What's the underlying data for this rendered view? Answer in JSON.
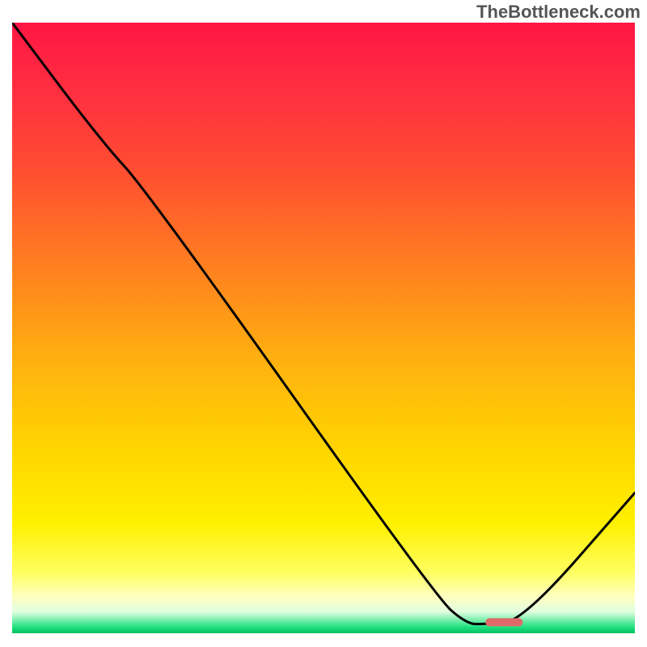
{
  "watermark": "TheBottleneck.com",
  "chart_data": {
    "type": "line",
    "title": "",
    "xlabel": "",
    "ylabel": "",
    "xlim": [
      0,
      100
    ],
    "ylim": [
      0,
      100
    ],
    "gradient_stops": [
      {
        "offset": 0.0,
        "color": "#ff1744"
      },
      {
        "offset": 0.12,
        "color": "#ff3040"
      },
      {
        "offset": 0.25,
        "color": "#ff5030"
      },
      {
        "offset": 0.4,
        "color": "#ff8020"
      },
      {
        "offset": 0.55,
        "color": "#ffb010"
      },
      {
        "offset": 0.7,
        "color": "#ffd500"
      },
      {
        "offset": 0.82,
        "color": "#fff000"
      },
      {
        "offset": 0.9,
        "color": "#ffff60"
      },
      {
        "offset": 0.94,
        "color": "#ffffc0"
      },
      {
        "offset": 0.965,
        "color": "#e0ffe0"
      },
      {
        "offset": 0.99,
        "color": "#20e080"
      },
      {
        "offset": 1.0,
        "color": "#00c060"
      }
    ],
    "curve": [
      {
        "x": 0,
        "y": 100
      },
      {
        "x": 14,
        "y": 81
      },
      {
        "x": 22,
        "y": 72
      },
      {
        "x": 68,
        "y": 6
      },
      {
        "x": 73,
        "y": 1.5
      },
      {
        "x": 76,
        "y": 1.5
      },
      {
        "x": 82,
        "y": 2
      },
      {
        "x": 100,
        "y": 23
      }
    ],
    "marker": {
      "x_start": 76,
      "x_end": 82,
      "y": 1.8,
      "color": "#e06a6a"
    }
  }
}
